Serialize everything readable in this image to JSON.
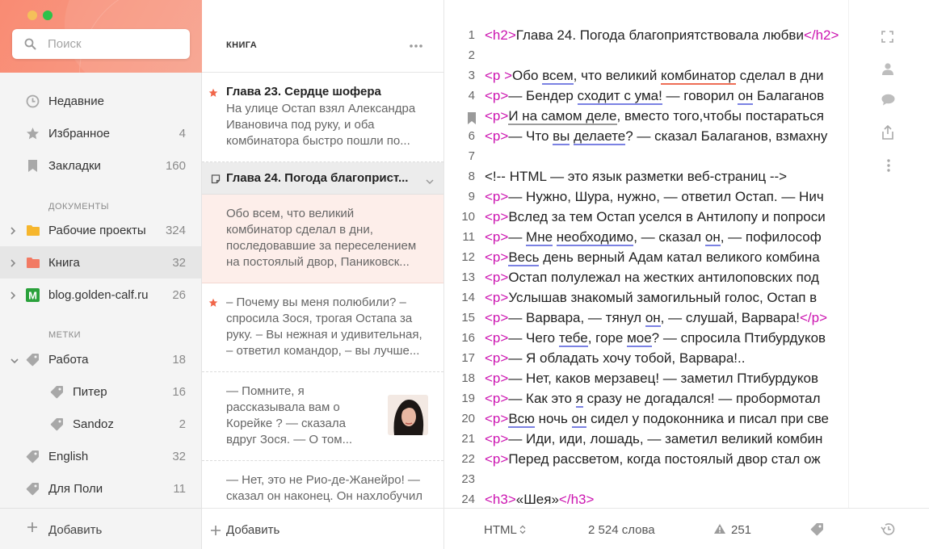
{
  "colors": {
    "accent": "#f98b73",
    "tag": "#cc14b0",
    "spell": "#7b82e3",
    "star": "#f0664a"
  },
  "sidebar": {
    "search_placeholder": "Поиск",
    "items": [
      {
        "label": "Недавние",
        "count": "",
        "icon": "clock-icon"
      },
      {
        "label": "Избранное",
        "count": "4",
        "icon": "star-icon"
      },
      {
        "label": "Закладки",
        "count": "160",
        "icon": "bookmark-icon"
      }
    ],
    "documents_heading": "ДОКУМЕНТЫ",
    "documents": [
      {
        "label": "Рабочие проекты",
        "count": "324",
        "icon": "folder-icon"
      },
      {
        "label": "Книга",
        "count": "32",
        "icon": "folder-icon"
      },
      {
        "label": "blog.golden-calf.ru",
        "count": "26",
        "icon": "m-blog-icon"
      }
    ],
    "tags_heading": "МЕТКИ",
    "tags": [
      {
        "label": "Работа",
        "count": "18"
      },
      {
        "label": "Питер",
        "count": "16"
      },
      {
        "label": "Sandoz",
        "count": "2"
      },
      {
        "label": "English",
        "count": "32"
      },
      {
        "label": "Для Поли",
        "count": "11"
      }
    ],
    "add_label": "Добавить"
  },
  "list": {
    "title": "КНИГА",
    "add_label": "Добавить",
    "notes": [
      {
        "title": "Глава 23. Сердце шофера",
        "lines": [
          "На улице Остап взял Александра",
          "Ивановича под руку, и оба",
          "комбинатора быстро пошли по..."
        ]
      },
      {
        "title": "Глава 24. Погода благоприст..."
      },
      {
        "lines": [
          "Обо всем, что великий",
          "комбинатор сделал в дни,",
          "последовавшие за переселением",
          "на постоялый двор, Паниковск..."
        ]
      },
      {
        "lines": [
          "– Почему вы меня полюбили? –",
          "спросила Зося, трогая Остапа за",
          "руку. – Вы нежная и удивительная,",
          "– ответил командор, – вы лучше..."
        ]
      },
      {
        "lines": [
          "— Помните, я",
          "рассказывала вам о",
          "Корейке ? — сказала",
          "вдруг Зося. — О том..."
        ]
      },
      {
        "lines": [
          "— Нет, это не Рио-де-Жанейро! —",
          "сказал он наконец. Он нахлобучил"
        ]
      }
    ]
  },
  "editor": {
    "lines": [
      {
        "n": "1",
        "t": "Глава 24. Погода благоприятствовала любви"
      },
      {
        "n": "2",
        "t": ""
      },
      {
        "n": "3",
        "a": "Обо ",
        "b": "всем",
        "c": ", что великий ",
        "d": "комбинатор",
        "e": " сделал в дни"
      },
      {
        "n": "4",
        "a": "— Бендер ",
        "b": "сходит с ума!",
        "c": " — говорил ",
        "d": "он",
        "e": " Балаганов"
      },
      {
        "n": "5",
        "a": "",
        "b": "И на самом деле",
        "c": ", вместо того,чтобы постараться"
      },
      {
        "n": "6",
        "a": "— Что ",
        "b": "вы",
        "c": " ",
        "d": "делаете",
        "e": "? — сказал Балаганов, взмахну"
      },
      {
        "n": "7",
        "t": ""
      },
      {
        "n": "8",
        "t": "<!-- HTML — это язык разметки веб-страниц -->"
      },
      {
        "n": "9",
        "t": "— Нужно, Шура, нужно, — ответил Остап. — Нич"
      },
      {
        "n": "10",
        "t": "Вслед за тем Остап уселся в Антилопу и попроси"
      },
      {
        "n": "11",
        "a": "— ",
        "b": "Мне",
        "c": " ",
        "d": "необходимо",
        "e": ", — сказал ",
        "f": "он",
        "g": ", — пофилософ"
      },
      {
        "n": "12",
        "a": "",
        "b": "Весь",
        "c": " день верный Адам катал великого комбина"
      },
      {
        "n": "13",
        "t": "Остап полулежал на жестких антилоповских под"
      },
      {
        "n": "14",
        "t": "Услышав знакомый замогильный голос, Остап в"
      },
      {
        "n": "15",
        "a": "— Варвара, — тянул ",
        "b": "он",
        "c": ", — слушай, Варвара!"
      },
      {
        "n": "16",
        "a": "— Чего ",
        "b": "тебе",
        "c": ", горе ",
        "d": "мое",
        "e": "? — спросила Птибурдуков"
      },
      {
        "n": "17",
        "t": "— Я обладать хочу тобой, Варвара!.."
      },
      {
        "n": "18",
        "t": "— Нет, каков мерзавец! — заметил Птибурдуков"
      },
      {
        "n": "19",
        "a": "— Как это ",
        "b": "я",
        "c": " сразу не догадался! — пробормотал"
      },
      {
        "n": "20",
        "a": "",
        "b": "Всю",
        "c": " ночь ",
        "d": "он",
        "e": " сидел у подоконника и писал при све"
      },
      {
        "n": "21",
        "t": "— Иди, иди, лошадь, — заметил великий комбин"
      },
      {
        "n": "22",
        "t": "Перед рассветом, когда постоялый двор стал ож"
      },
      {
        "n": "23",
        "t": ""
      },
      {
        "n": "24",
        "t": "«Шея»"
      }
    ],
    "status": {
      "syntax": "HTML",
      "words": "2 524 слова",
      "warnings": "251"
    }
  }
}
